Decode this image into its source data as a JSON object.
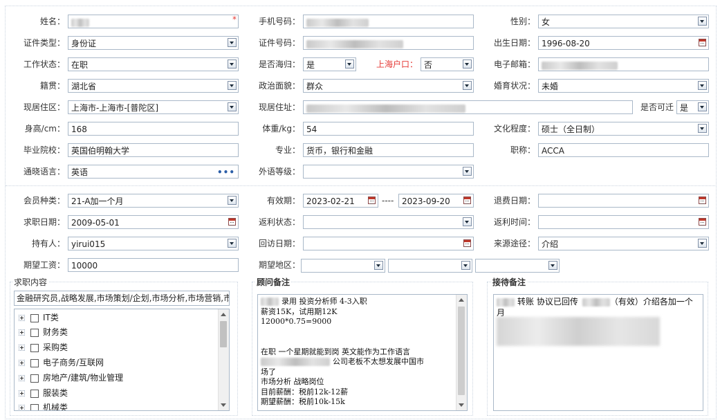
{
  "personal": {
    "name_label": "姓名：",
    "mobile_label": "手机号码：",
    "gender_label": "性别：",
    "gender_value": "女",
    "id_type_label": "证件类型：",
    "id_type_value": "身份证",
    "id_no_label": "证件号码：",
    "birth_label": "出生日期：",
    "birth_value": "1996-08-20",
    "work_status_label": "工作状态：",
    "work_status_value": "在职",
    "overseas_label": "是否海归：",
    "overseas_value": "是",
    "hukou_label": "上海户口：",
    "hukou_value": "否",
    "email_label": "电子邮箱：",
    "native_label": "籍贯：",
    "native_value": "湖北省",
    "political_label": "政治面貌：",
    "political_value": "群众",
    "marital_label": "婚育状况：",
    "marital_value": "未婚",
    "district_label": "现居住区：",
    "district_value": "上海市-上海市-[普陀区]",
    "address_label": "现居住址：",
    "relocate_label": "是否可迁",
    "relocate_value": "是",
    "height_label": "身高/cm：",
    "height_value": "168",
    "weight_label": "体重/kg：",
    "weight_value": "54",
    "education_label": "文化程度：",
    "education_value": "硕士（全日制）",
    "school_label": "毕业院校：",
    "school_value": "英国伯明翰大学",
    "major_label": "专业：",
    "major_value": "货币，银行和金融",
    "title_label": "职称：",
    "title_value": "ACCA",
    "language_label": "通晓语言：",
    "language_value": "英语",
    "language_more": "•••",
    "foreign_level_label": "外语等级："
  },
  "membership": {
    "member_type_label": "会员种类：",
    "member_type_value": "21-A加一个月",
    "valid_label": "有效期：",
    "valid_from": "2023-02-21",
    "valid_sep": "----",
    "valid_to": "2023-09-20",
    "refund_date_label": "退费日期：",
    "job_date_label": "求职日期：",
    "job_date_value": "2009-05-01",
    "rebate_status_label": "返利状态：",
    "rebate_time_label": "返利时间：",
    "holder_label": "持有人：",
    "holder_value": "yirui015",
    "visit_date_label": "回访日期：",
    "source_label": "来源途径：",
    "source_value": "介绍",
    "salary_label": "期望工资：",
    "salary_value": "10000",
    "region_label": "期望地区："
  },
  "job_panel": {
    "title": "求职内容",
    "summary": "金融研究员,战略发展,市场策划/企划,市场分析,市场营销,市",
    "tree": [
      "IT类",
      "财务类",
      "采购类",
      "电子商务/互联网",
      "房地产/建筑/物业管理",
      "服装类",
      "机械类"
    ]
  },
  "consultant_panel": {
    "title": "顾问备注",
    "lines": [
      "录用 投资分析师 4-3入职",
      "薪资15K，试用期12K",
      "12000*0.75=9000",
      "",
      "",
      "在职 一个星期就能到岗 英文能作为工作语言",
      "公司老板不太想发展中国市",
      "场了",
      "市场分析 战略岗位",
      "目前薪酬：税前12k-12薪",
      "期望薪酬：税前10k-15k"
    ]
  },
  "reception_panel": {
    "title": "接待备注",
    "line1_a": "转账 协议已回传",
    "line1_b": "（有效）介绍各加一个月"
  }
}
